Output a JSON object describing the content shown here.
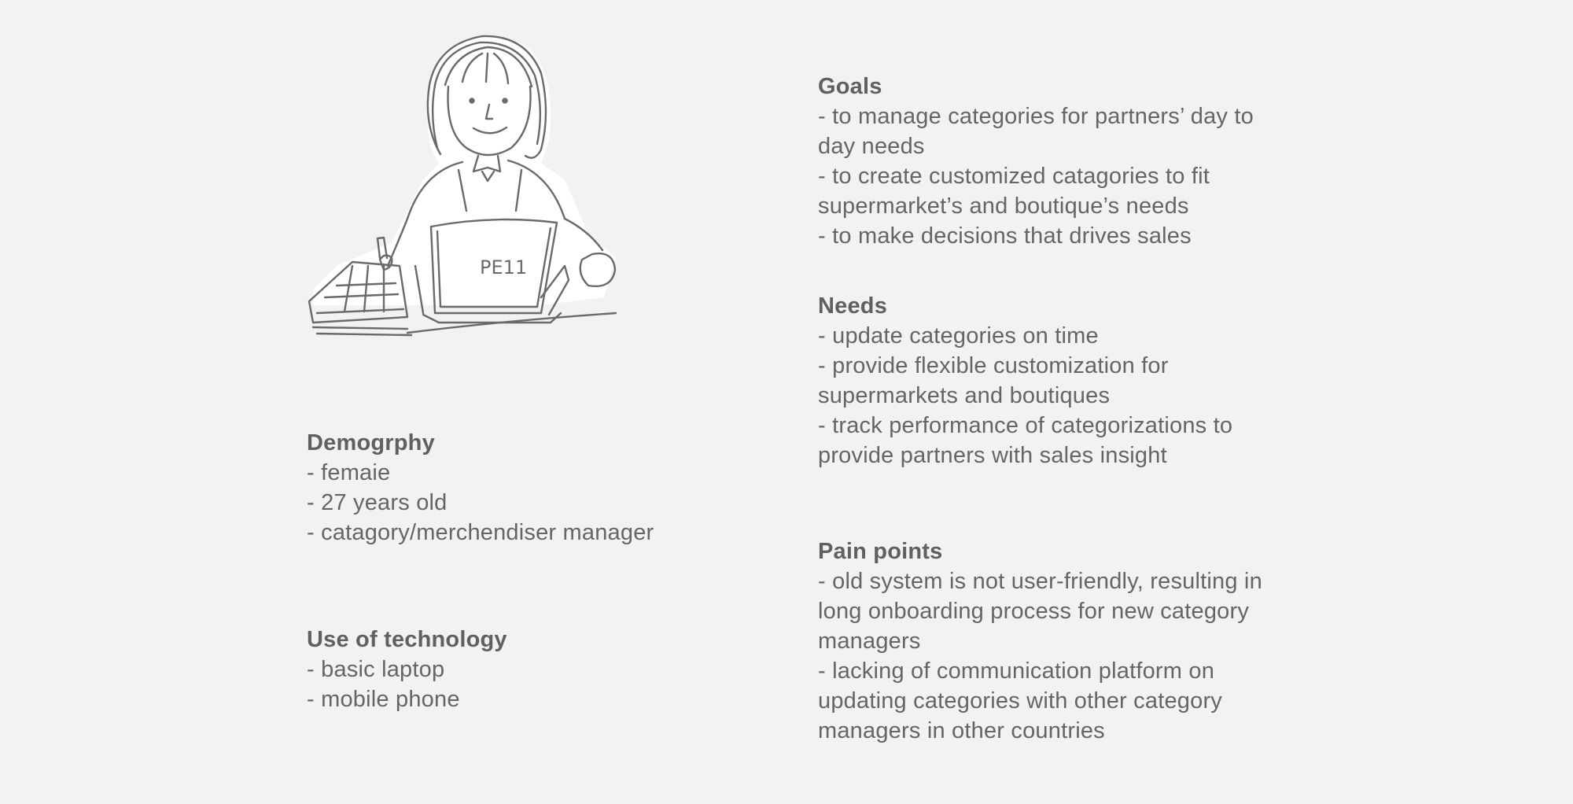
{
  "illustration": {
    "laptop_text": "PE11"
  },
  "demography": {
    "title": "Demogrphy",
    "items": [
      "- femaie",
      "- 27 years old",
      "- catagory/merchendiser manager"
    ]
  },
  "technology": {
    "title": "Use of technology",
    "items": [
      "- basic laptop",
      "- mobile phone"
    ]
  },
  "goals": {
    "title": "Goals",
    "items": [
      "- to manage categories for partners’ day to day needs",
      "- to create customized catagories to fit supermarket’s and boutique’s needs",
      "- to make decisions that drives sales"
    ]
  },
  "needs": {
    "title": "Needs",
    "items": [
      "- update categories on time",
      "- provide flexible customization for supermarkets and boutiques",
      "- track performance of categorizations to provide partners with sales insight"
    ]
  },
  "pain_points": {
    "title": "Pain points",
    "items": [
      "- old system is not user-friendly, resulting in long onboarding process for new category managers",
      "- lacking of communication platform on updating categories with other category managers in other countries"
    ]
  }
}
